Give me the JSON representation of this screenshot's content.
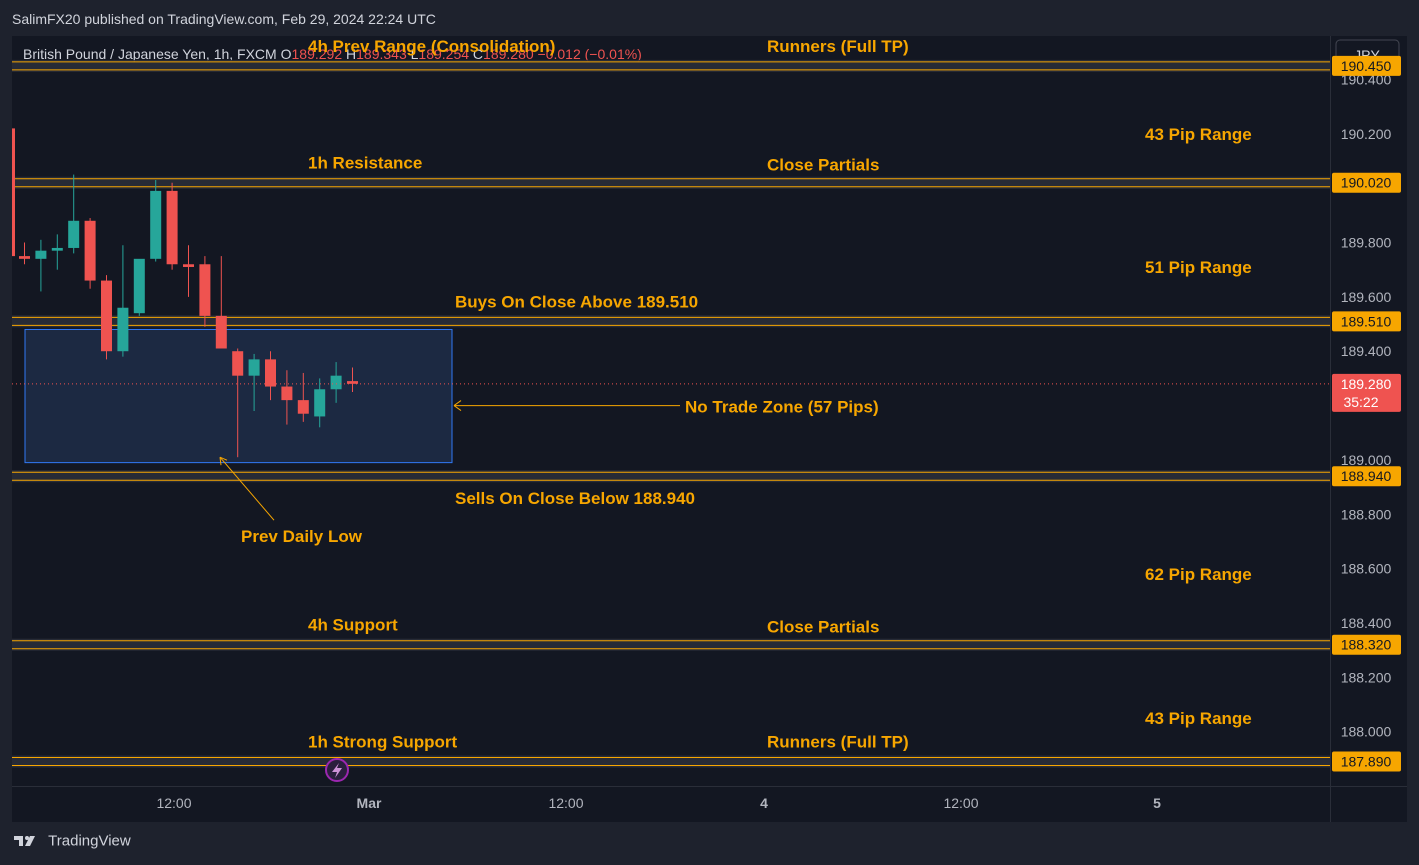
{
  "header": {
    "published": "SalimFX20 published on TradingView.com, Feb 29, 2024 22:24 UTC"
  },
  "footer": {
    "brand": "TradingView"
  },
  "currency_button": "JPY",
  "chart_data": {
    "type": "candlestick",
    "symbol_line": {
      "name": "British Pound / Japanese Yen, 1h, FXCM",
      "o_label": "O",
      "o": "189.292",
      "h_label": "H",
      "h": "189.343",
      "l_label": "L",
      "l": "189.254",
      "c_label": "C",
      "c": "189.280",
      "change": "−0.012 (−0.01%)"
    },
    "ylim": [
      187.8,
      190.56
    ],
    "y_ticks": [
      {
        "value": 190.4,
        "label": "190.400"
      },
      {
        "value": 190.2,
        "label": "190.200"
      },
      {
        "value": 189.8,
        "label": "189.800"
      },
      {
        "value": 189.6,
        "label": "189.600"
      },
      {
        "value": 189.4,
        "label": "189.400"
      },
      {
        "value": 189.0,
        "label": "189.000"
      },
      {
        "value": 188.8,
        "label": "188.800"
      },
      {
        "value": 188.6,
        "label": "188.600"
      },
      {
        "value": 188.4,
        "label": "188.400"
      },
      {
        "value": 188.2,
        "label": "188.200"
      },
      {
        "value": 188.0,
        "label": "188.000"
      }
    ],
    "x_ticks": [
      "12:00",
      "Mar",
      "12:00",
      "4",
      "12:00",
      "5"
    ],
    "candles": [
      {
        "o": 189.75,
        "h": 189.8,
        "l": 189.72,
        "c": 189.74
      },
      {
        "o": 189.74,
        "h": 189.81,
        "l": 189.62,
        "c": 189.77
      },
      {
        "o": 189.77,
        "h": 189.83,
        "l": 189.7,
        "c": 189.78
      },
      {
        "o": 189.78,
        "h": 190.05,
        "l": 189.76,
        "c": 189.88
      },
      {
        "o": 189.88,
        "h": 189.89,
        "l": 189.63,
        "c": 189.66
      },
      {
        "o": 189.66,
        "h": 189.68,
        "l": 189.37,
        "c": 189.4
      },
      {
        "o": 189.4,
        "h": 189.79,
        "l": 189.38,
        "c": 189.56
      },
      {
        "o": 189.54,
        "h": 189.64,
        "l": 189.53,
        "c": 189.74
      },
      {
        "o": 189.74,
        "h": 190.03,
        "l": 189.73,
        "c": 189.99
      },
      {
        "o": 189.99,
        "h": 190.02,
        "l": 189.7,
        "c": 189.72
      },
      {
        "o": 189.72,
        "h": 189.79,
        "l": 189.6,
        "c": 189.71
      },
      {
        "o": 189.72,
        "h": 189.75,
        "l": 189.49,
        "c": 189.53
      },
      {
        "o": 189.53,
        "h": 189.75,
        "l": 189.48,
        "c": 189.41
      },
      {
        "o": 189.4,
        "h": 189.41,
        "l": 189.01,
        "c": 189.31
      },
      {
        "o": 189.31,
        "h": 189.39,
        "l": 189.18,
        "c": 189.37
      },
      {
        "o": 189.37,
        "h": 189.4,
        "l": 189.22,
        "c": 189.27
      },
      {
        "o": 189.27,
        "h": 189.33,
        "l": 189.13,
        "c": 189.22
      },
      {
        "o": 189.22,
        "h": 189.32,
        "l": 189.14,
        "c": 189.17
      },
      {
        "o": 189.16,
        "h": 189.3,
        "l": 189.12,
        "c": 189.26
      },
      {
        "o": 189.26,
        "h": 189.36,
        "l": 189.21,
        "c": 189.31
      },
      {
        "o": 189.29,
        "h": 189.34,
        "l": 189.25,
        "c": 189.28
      }
    ],
    "levels": [
      {
        "value": 190.45,
        "label": "190.450",
        "left_text": "4h Prev Range (Consolidation)",
        "right_text": "Runners (Full TP)"
      },
      {
        "value": 190.02,
        "label": "190.020",
        "left_text": "1h Resistance",
        "right_text": "Close Partials"
      },
      {
        "value": 189.51,
        "label": "189.510",
        "left_text": "Buys On Close Above 189.510",
        "right_text": ""
      },
      {
        "value": 188.94,
        "label": "188.940",
        "left_text": "Sells On Close Below 188.940",
        "right_text": ""
      },
      {
        "value": 188.32,
        "label": "188.320",
        "left_text": "4h Support",
        "right_text": "Close Partials"
      },
      {
        "value": 187.89,
        "label": "187.890",
        "left_text": "1h Strong Support",
        "right_text": "Runners (Full TP)"
      }
    ],
    "ranges": [
      {
        "text": "43 Pip Range",
        "value": 190.2
      },
      {
        "text": "51 Pip Range",
        "value": 189.71
      },
      {
        "text": "62 Pip Range",
        "value": 188.58
      },
      {
        "text": "43 Pip Range",
        "value": 188.05
      }
    ],
    "no_trade_zone": {
      "top": 189.48,
      "bottom": 188.99,
      "text": "No Trade Zone (57 Pips)",
      "arrow_value": 189.2
    },
    "prev_daily_low": {
      "text": "Prev Daily Low",
      "value": 189.01
    },
    "current_price": {
      "value": 189.28,
      "label": "189.280",
      "countdown": "35:22"
    },
    "colors": {
      "up": "#26a69a",
      "down": "#ef5350",
      "level": "#f7a600",
      "annotation": "#f7a600",
      "zone": "#1c2a45",
      "zone_border": "#3179f5"
    }
  }
}
